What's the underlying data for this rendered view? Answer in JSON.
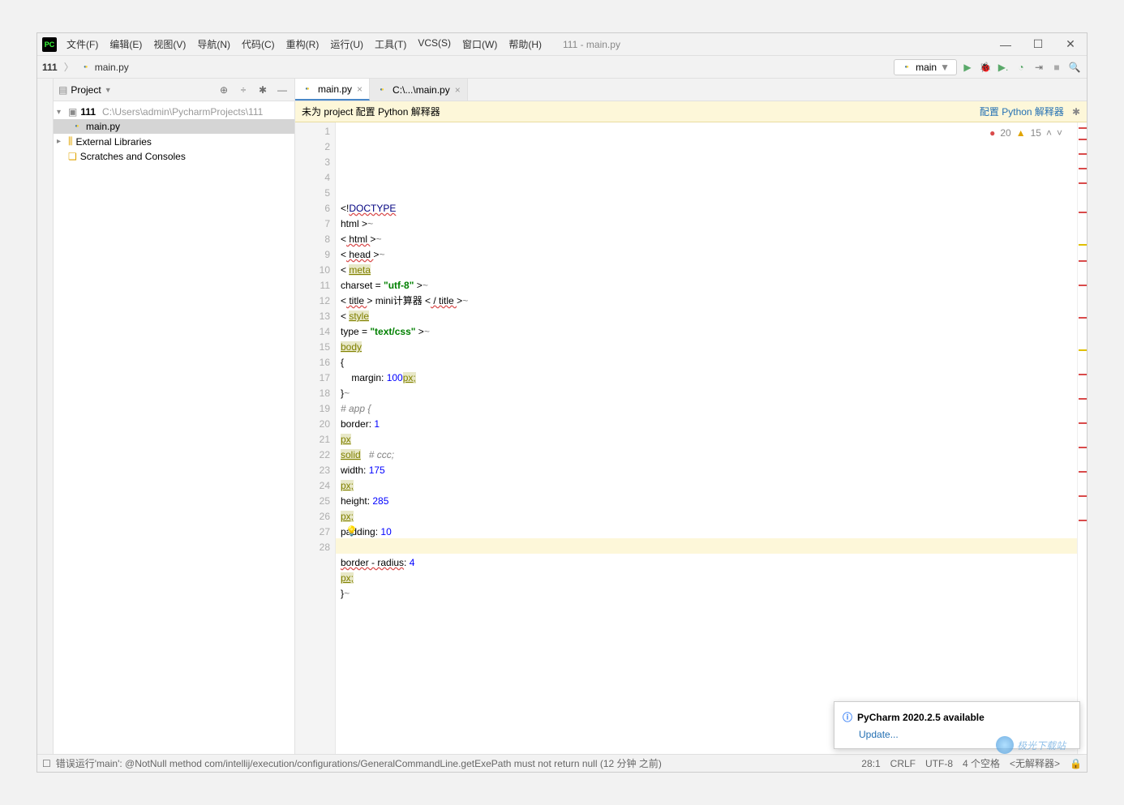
{
  "title": "111 - main.py",
  "menu": [
    "文件(F)",
    "编辑(E)",
    "视图(V)",
    "导航(N)",
    "代码(C)",
    "重构(R)",
    "运行(U)",
    "工具(T)",
    "VCS(S)",
    "窗口(W)",
    "帮助(H)"
  ],
  "breadcrumb": {
    "project": "111",
    "file": "main.py"
  },
  "run_config": "main",
  "sidebar": {
    "title": "Project",
    "project_root": "111",
    "project_path": "C:\\Users\\admin\\PycharmProjects\\111",
    "file": "main.py",
    "ext_lib": "External Libraries",
    "scratches": "Scratches and Consoles"
  },
  "tabs": [
    {
      "label": "main.py",
      "active": true
    },
    {
      "label": "C:\\...\\main.py",
      "active": false
    }
  ],
  "banner": {
    "text": "未为 project 配置 Python 解释器",
    "action": "配置 Python 解释器"
  },
  "inspection": {
    "errors": 20,
    "warnings": 15
  },
  "code_lines": [
    {
      "n": 1,
      "html": "&lt;!<span class='kw err-u'>DOCTYPE</span>"
    },
    {
      "n": 2,
      "html": "html &gt;<span class='com'>~</span>"
    },
    {
      "n": 3,
      "html": "&lt;<span class='err-u'> html </span>&gt;<span class='com'>~</span>"
    },
    {
      "n": 4,
      "html": "&lt;<span class='err-u'> head </span>&gt;<span class='com'>~</span>"
    },
    {
      "n": 5,
      "html": "&lt; <span class='olive'>meta</span>"
    },
    {
      "n": 6,
      "html": "charset = <span class='str'>\"utf-8\"</span> &gt;<span class='com'>~</span>"
    },
    {
      "n": 7,
      "html": "&lt;<span class='err-u'> title </span>&gt; mini计算器 &lt;<span class='err-u'> / title </span>&gt;<span class='com'>~</span>"
    },
    {
      "n": 8,
      "html": "&lt; <span class='olive'>style</span>"
    },
    {
      "n": 9,
      "html": "type = <span class='str'>\"text/css\"</span> &gt;<span class='com'>~</span>"
    },
    {
      "n": 10,
      "html": "<span class='olive'>body</span>"
    },
    {
      "n": 11,
      "html": "{"
    },
    {
      "n": 12,
      "html": "    margin: <span class='num'>100</span><span class='olive'>px;</span>"
    },
    {
      "n": 13,
      "html": "}<span class='com'>~</span>"
    },
    {
      "n": 14,
      "html": "<span class='com'># app {</span>"
    },
    {
      "n": 15,
      "html": "border: <span class='num'>1</span>"
    },
    {
      "n": 16,
      "html": "<span class='olive'>px</span>"
    },
    {
      "n": 17,
      "html": "<span class='olive'>solid</span>   <span class='com'># ccc;</span>"
    },
    {
      "n": 18,
      "html": "width: <span class='num'>175</span>"
    },
    {
      "n": 19,
      "html": "<span class='olive'>px;</span>"
    },
    {
      "n": 20,
      "html": "height: <span class='num'>285</span>"
    },
    {
      "n": 21,
      "html": "<span class='olive'>px;</span>"
    },
    {
      "n": 22,
      "html": "padding: <span class='num'>10</span>"
    },
    {
      "n": 23,
      "html": "<span class='olive'>px;</span>"
    },
    {
      "n": 24,
      "html": "<span class='err-u'>border - radius</span>: <span class='num'>4</span>"
    },
    {
      "n": 25,
      "html": "<span class='olive'>px;</span>"
    },
    {
      "n": 26,
      "html": "}<span class='com'>~</span>"
    },
    {
      "n": 27,
      "html": ""
    },
    {
      "n": 28,
      "html": ""
    }
  ],
  "popup": {
    "title": "PyCharm 2020.2.5 available",
    "link": "Update..."
  },
  "status": {
    "left": "错误运行'main': @NotNull method com/intellij/execution/configurations/GeneralCommandLine.getExePath must not return null (12 分钟 之前)",
    "pos": "28:1",
    "eol": "CRLF",
    "enc": "UTF-8",
    "indent": "4 个空格",
    "interp": "<无解释器>"
  },
  "watermark": "极光下载站"
}
